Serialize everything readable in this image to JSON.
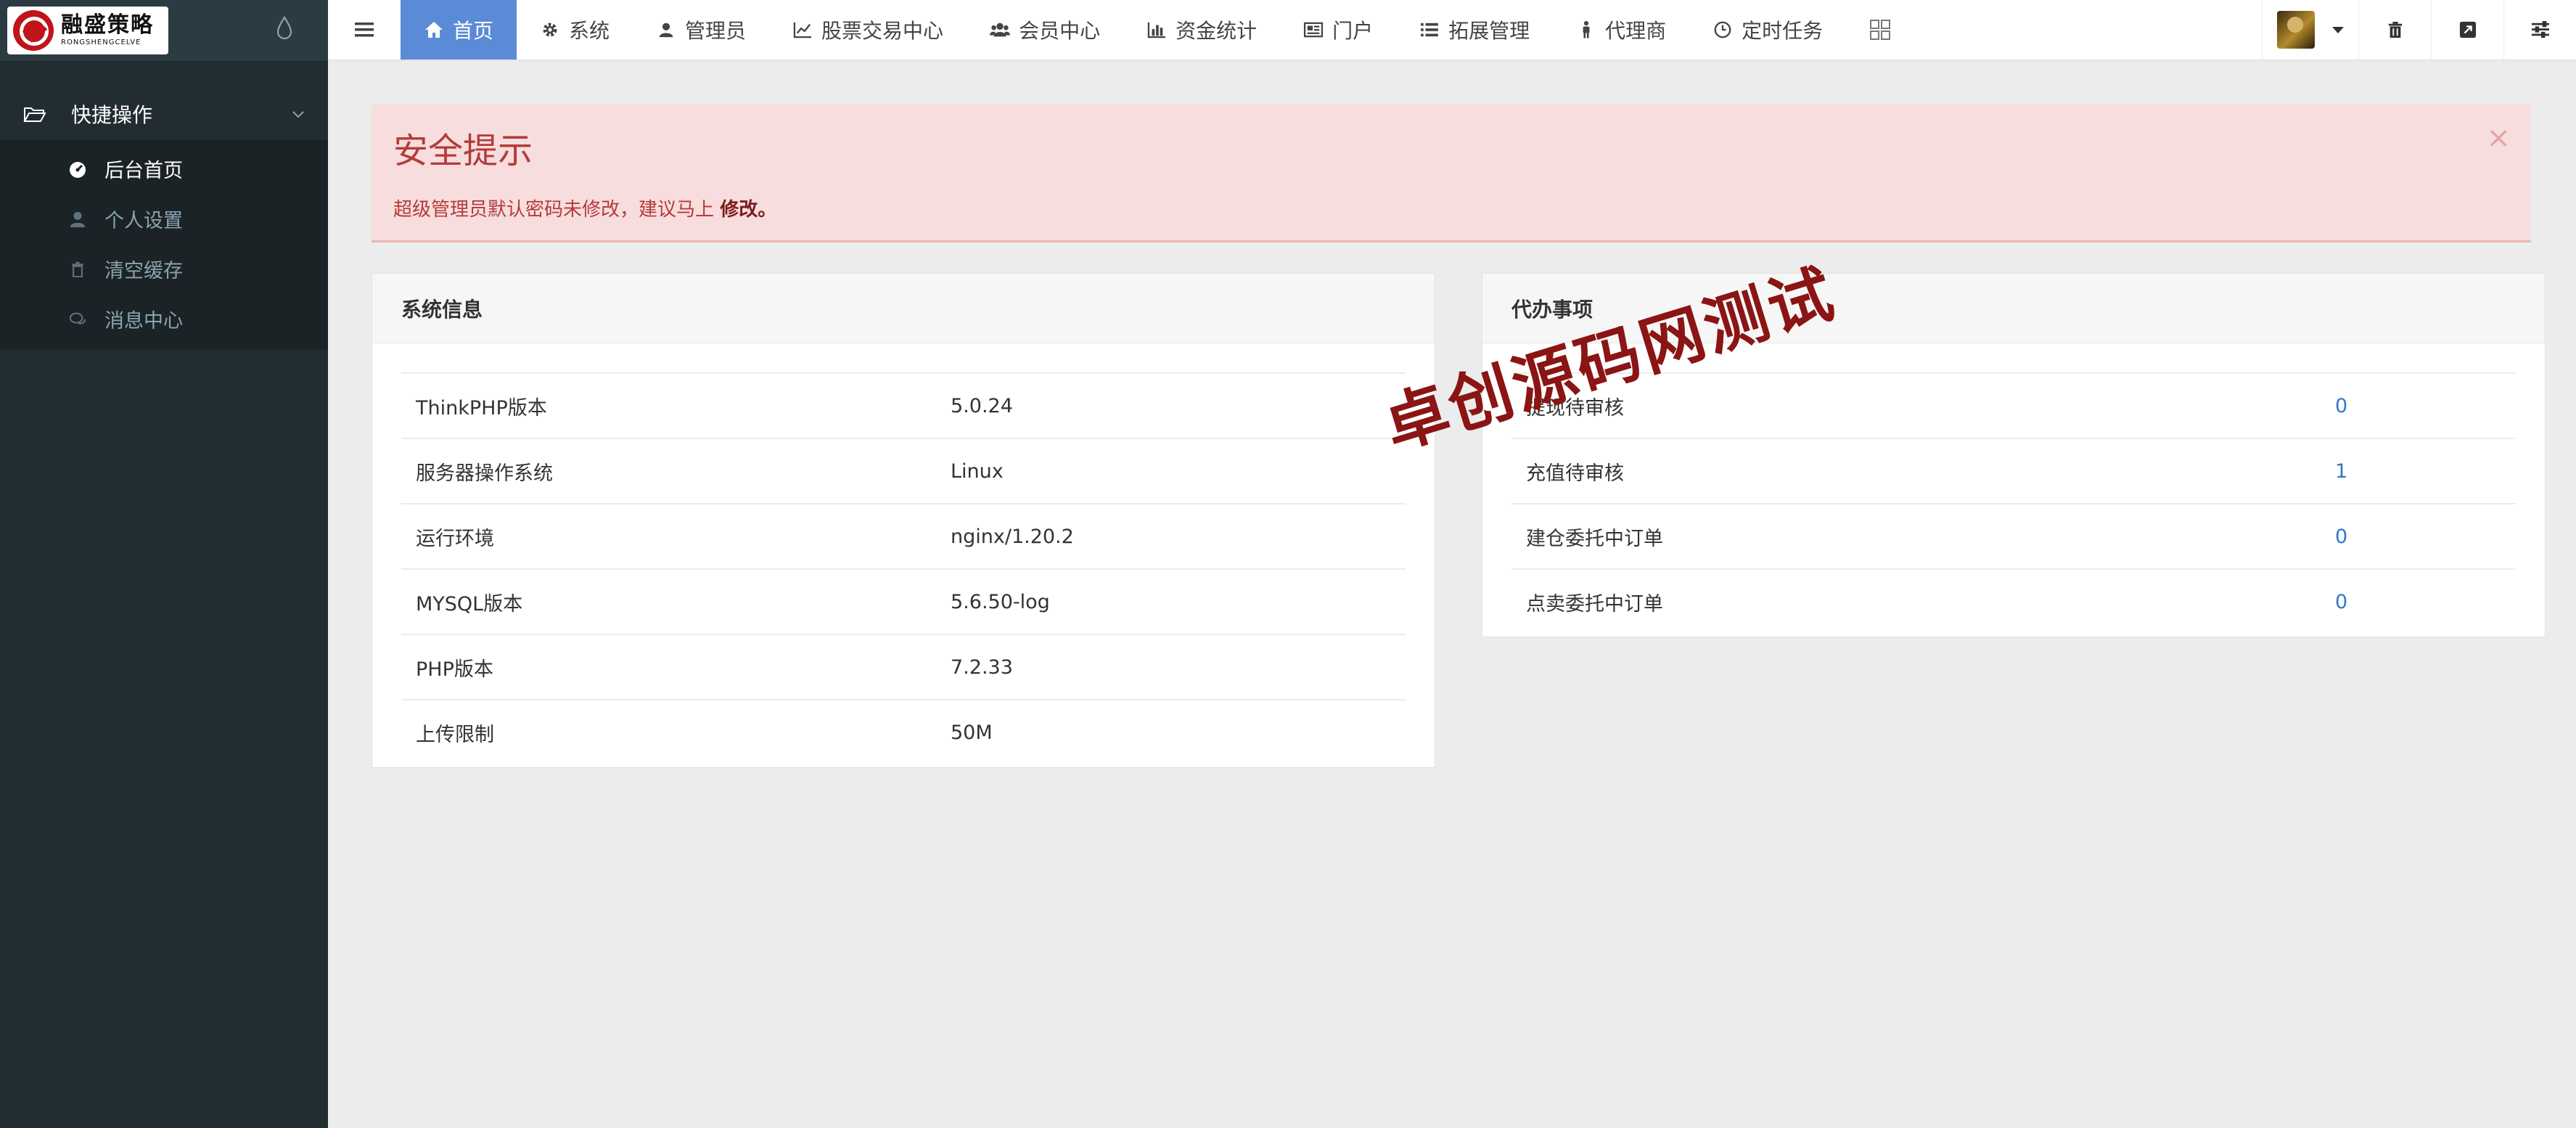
{
  "brand": {
    "name_cn": "融盛策略",
    "name_en": "RONGSHENGCELVE"
  },
  "sidebar": {
    "section_label": "快捷操作",
    "items": [
      {
        "label": "后台首页",
        "icon": "dashboard-icon",
        "active": true
      },
      {
        "label": "个人设置",
        "icon": "user-icon",
        "active": false
      },
      {
        "label": "清空缓存",
        "icon": "trash-icon",
        "active": false
      },
      {
        "label": "消息中心",
        "icon": "comments-icon",
        "active": false
      }
    ]
  },
  "topnav": {
    "items": [
      {
        "label": "首页",
        "icon": "home-icon",
        "active": true
      },
      {
        "label": "系统",
        "icon": "gear-icon"
      },
      {
        "label": "管理员",
        "icon": "user-icon"
      },
      {
        "label": "股票交易中心",
        "icon": "line-chart-icon"
      },
      {
        "label": "会员中心",
        "icon": "users-icon"
      },
      {
        "label": "资金统计",
        "icon": "bar-chart-icon"
      },
      {
        "label": "门户",
        "icon": "newspaper-icon"
      },
      {
        "label": "拓展管理",
        "icon": "list-icon"
      },
      {
        "label": "代理商",
        "icon": "person-icon"
      },
      {
        "label": "定时任务",
        "icon": "clock-icon"
      }
    ]
  },
  "alert": {
    "title": "安全提示",
    "message": "超级管理员默认密码未修改，建议马上",
    "link_text": "修改。",
    "close": "×"
  },
  "system_info": {
    "title": "系统信息",
    "rows": [
      {
        "key": "ThinkPHP版本",
        "value": "5.0.24"
      },
      {
        "key": "服务器操作系统",
        "value": "Linux"
      },
      {
        "key": "运行环境",
        "value": "nginx/1.20.2"
      },
      {
        "key": "MYSQL版本",
        "value": "5.6.50-log"
      },
      {
        "key": "PHP版本",
        "value": "7.2.33"
      },
      {
        "key": "上传限制",
        "value": "50M"
      }
    ]
  },
  "todo": {
    "title": "代办事项",
    "rows": [
      {
        "key": "提现待审核",
        "value": "0"
      },
      {
        "key": "充值待审核",
        "value": "1"
      },
      {
        "key": "建仓委托中订单",
        "value": "0"
      },
      {
        "key": "点卖委托中订单",
        "value": "0"
      }
    ]
  },
  "watermark": "卓创源码网测试",
  "colors": {
    "sidebar_bg": "#222d32",
    "nav_active": "#5b8bd6",
    "alert_bg": "#f7dddd",
    "alert_text": "#b43b3b",
    "link": "#3277c2",
    "watermark": "#8b1414"
  }
}
